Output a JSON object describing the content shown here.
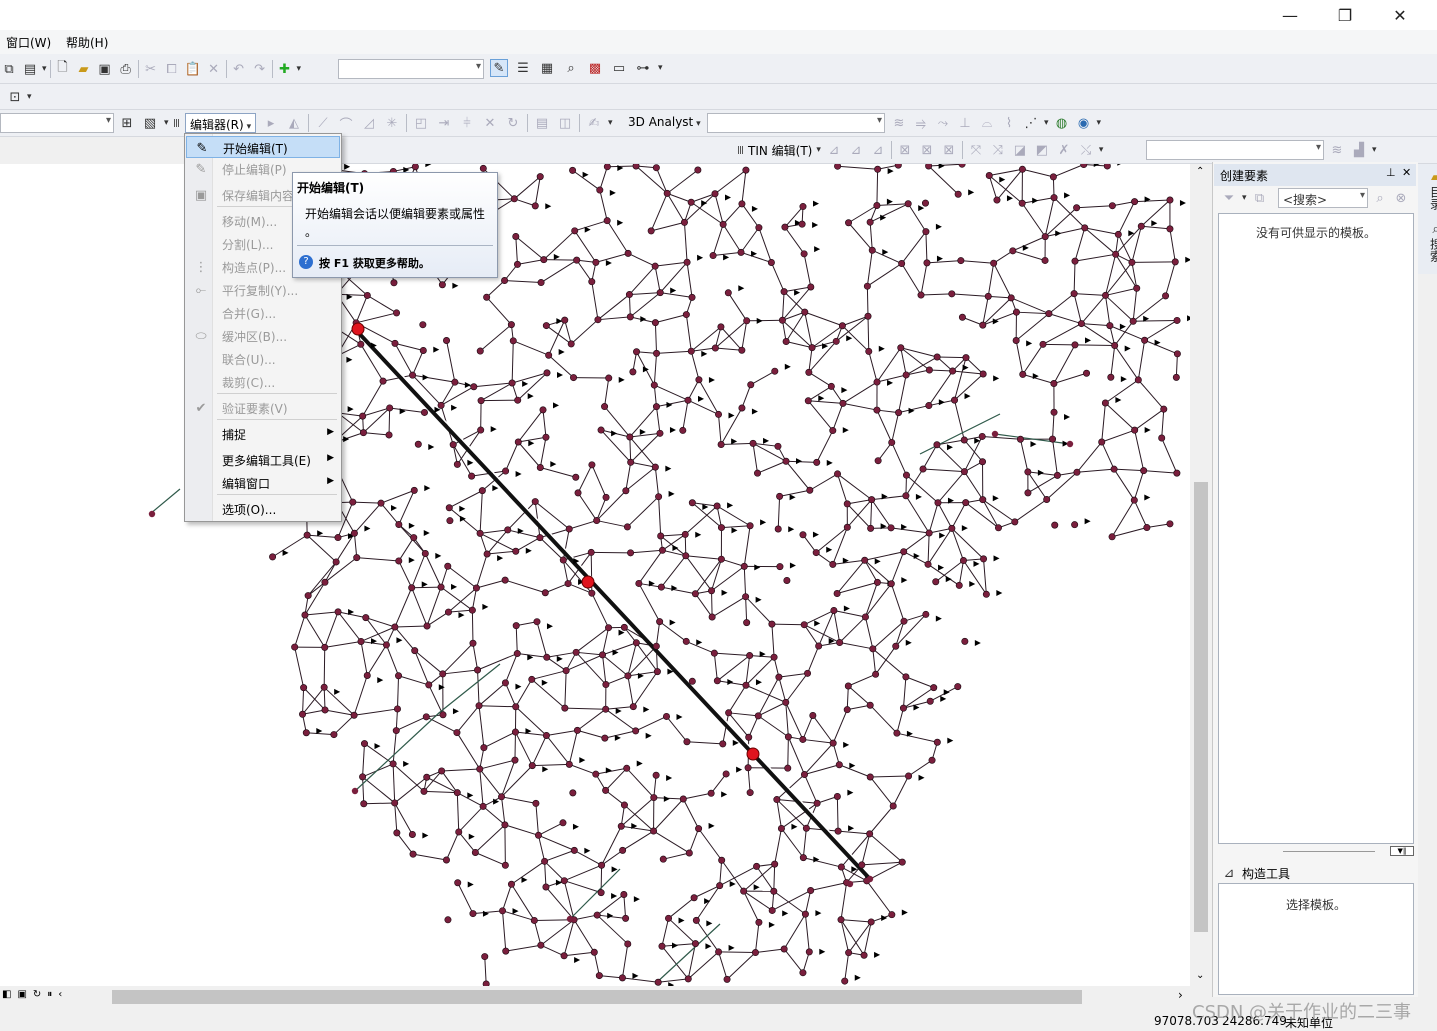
{
  "window": {
    "minimize_glyph": "—",
    "restore_glyph": "❐",
    "close_glyph": "✕"
  },
  "menubar": {
    "window_menu": "窗口(W)",
    "help_menu": "帮助(H)"
  },
  "toolbar_editor": {
    "editor_label": "编辑器(R)",
    "analyst_label": "3D Analyst",
    "tin_label": "TIN 编辑(T)"
  },
  "editor_menu": {
    "items": [
      {
        "label": "开始编辑(T)",
        "icon": "pencil-icon",
        "enabled": true,
        "highlighted": true
      },
      {
        "label": "停止编辑(P)",
        "icon": "stop-pencil-icon",
        "enabled": false
      },
      {
        "label": "保存编辑内容",
        "icon": "save-edits-icon",
        "enabled": false
      },
      {
        "label": "移动(M)...",
        "enabled": false
      },
      {
        "label": "分割(L)...",
        "enabled": false
      },
      {
        "label": "构造点(P)...",
        "icon": "construct-points-icon",
        "enabled": false
      },
      {
        "label": "平行复制(Y)...",
        "icon": "copy-parallel-icon",
        "enabled": false
      },
      {
        "label": "合并(G)...",
        "enabled": false
      },
      {
        "label": "缓冲区(B)...",
        "icon": "buffer-icon",
        "enabled": false
      },
      {
        "label": "联合(U)...",
        "enabled": false
      },
      {
        "label": "裁剪(C)...",
        "enabled": false
      },
      {
        "label": "验证要素(V)",
        "icon": "validate-icon",
        "enabled": false
      },
      {
        "label": "捕捉",
        "enabled": true,
        "submenu": true
      },
      {
        "label": "更多编辑工具(E)",
        "enabled": true,
        "submenu": true
      },
      {
        "label": "编辑窗口",
        "enabled": true,
        "submenu": true
      },
      {
        "label": "选项(O)...",
        "enabled": true
      }
    ]
  },
  "tooltip": {
    "title": "开始编辑(T)",
    "body_line1": "开始编辑会话以便编辑要素或属性",
    "body_line2": "。",
    "help": "按 F1 获取更多帮助。"
  },
  "create_features": {
    "title": "创建要素",
    "pin_glyph": "⊥",
    "close_glyph": "✕",
    "search_placeholder": "<搜索>",
    "empty_message": "没有可供显示的模板。",
    "construct_tools_title": "构造工具",
    "construct_tools_message": "选择模板。"
  },
  "side_tabs": {
    "catalog": "目录",
    "search": "搜索"
  },
  "status": {
    "x": "97078.703",
    "y": "24286.749",
    "unit": "未知单位"
  },
  "watermark": "CSDN @关于作业的二三事",
  "colors": {
    "node": "#7a1f3d",
    "edge": "#2f5a4a",
    "highlight_node": "#e0141e",
    "menu_highlight": "#c5def7"
  }
}
